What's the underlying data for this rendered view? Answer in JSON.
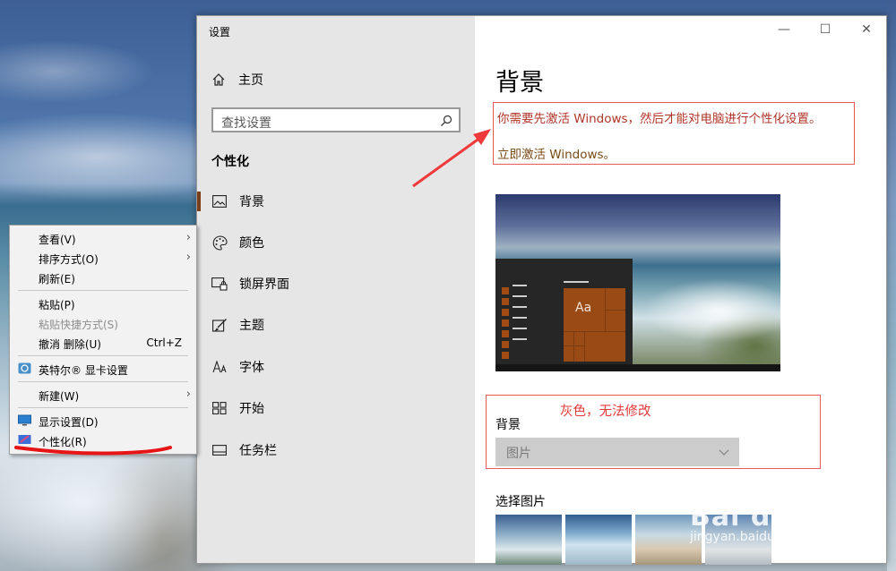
{
  "window": {
    "title": "设置",
    "controls": {
      "minimize": "—",
      "maximize": "☐",
      "close": "✕"
    }
  },
  "nav": {
    "home": "主页",
    "search_placeholder": "查找设置",
    "section": "个性化",
    "items": [
      {
        "label": "背景",
        "icon": "picture-icon",
        "active": true
      },
      {
        "label": "颜色",
        "icon": "palette-icon",
        "active": false
      },
      {
        "label": "锁屏界面",
        "icon": "lock-screen-icon",
        "active": false
      },
      {
        "label": "主题",
        "icon": "theme-brush-icon",
        "active": false
      },
      {
        "label": "字体",
        "icon": "font-icon",
        "active": false
      },
      {
        "label": "开始",
        "icon": "start-grid-icon",
        "active": false
      },
      {
        "label": "任务栏",
        "icon": "taskbar-icon",
        "active": false
      }
    ]
  },
  "content": {
    "title": "背景",
    "notice": {
      "text": "你需要先激活 Windows，然后才能对电脑进行个性化设置。",
      "link": "立即激活 Windows。"
    },
    "preview": {
      "tile_label": "Aa"
    },
    "annotation": "灰色，无法修改",
    "background_label": "背景",
    "background_select": "图片",
    "choose_picture_label": "选择图片"
  },
  "context_menu": {
    "items": [
      {
        "label": "查看(V)",
        "submenu": true,
        "disabled": false
      },
      {
        "label": "排序方式(O)",
        "submenu": true,
        "disabled": false
      },
      {
        "label": "刷新(E)",
        "submenu": false,
        "disabled": false
      },
      {
        "label": "粘贴(P)",
        "submenu": false,
        "disabled": false
      },
      {
        "label": "粘贴快捷方式(S)",
        "submenu": false,
        "disabled": true
      },
      {
        "label": "撤消 删除(U)",
        "shortcut": "Ctrl+Z",
        "submenu": false,
        "disabled": false
      },
      {
        "label": "英特尔® 显卡设置",
        "icon": "intel-graphics-icon",
        "submenu": false,
        "disabled": false
      },
      {
        "label": "新建(W)",
        "submenu": true,
        "disabled": false
      },
      {
        "label": "显示设置(D)",
        "icon": "display-icon",
        "submenu": false,
        "disabled": false
      },
      {
        "label": "个性化(R)",
        "icon": "personalize-icon",
        "submenu": false,
        "disabled": false
      }
    ]
  },
  "colors": {
    "accent": "#7a3e18",
    "annotation_red": "#e33a3a",
    "notice_text": "#b0362a"
  },
  "watermark": {
    "brand": "Bai du 经验",
    "url": "jingyan.baidu.com"
  }
}
